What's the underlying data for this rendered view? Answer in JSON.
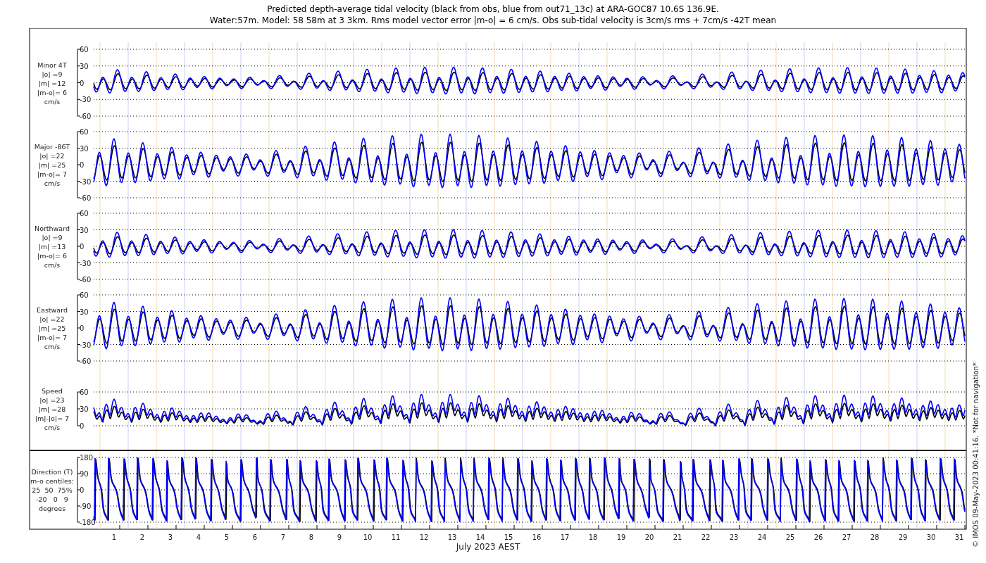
{
  "title": [
    "Predicted depth-average tidal velocity (black from obs, blue from out71_13c) at ARA-GOC87 10.6S 136.9E.",
    "Water:57m. Model: 58 58m at 3 3km. Rms model vector error |m-o| = 6 cm/s. Obs sub-tidal velocity is 3cm/s rms + 7cm/s -42T mean"
  ],
  "panels": [
    {
      "kind": "minor",
      "label": [
        "Minor 4T",
        "|o| =9",
        "|m| =12",
        "|m-o|= 6",
        "cm/s"
      ],
      "yticks": [
        "60",
        "30",
        "0",
        "-30",
        "-60"
      ]
    },
    {
      "kind": "major",
      "label": [
        "Major -86T",
        "|o| =22",
        "|m| =25",
        "|m-o|= 7",
        "cm/s"
      ],
      "yticks": [
        "60",
        "30",
        "0",
        "-30",
        "-60"
      ]
    },
    {
      "kind": "northward",
      "label": [
        "Northward",
        "|o| =9",
        "|m| =13",
        "|m-o|= 6",
        "cm/s"
      ],
      "yticks": [
        "60",
        "30",
        "0",
        "-30",
        "-60"
      ]
    },
    {
      "kind": "eastward",
      "label": [
        "Eastward",
        "|o| =22",
        "|m| =25",
        "|m-o|= 7",
        "cm/s"
      ],
      "yticks": [
        "60",
        "30",
        "0",
        "-30",
        "-60"
      ]
    },
    {
      "kind": "speed",
      "label": [
        "Speed",
        "|o| =23",
        "|m| =28",
        "|m|-|o|= 7",
        "cm/s"
      ],
      "yticks": [
        "60",
        "30",
        "0"
      ]
    },
    {
      "kind": "direction",
      "label": [
        "Direction (T)",
        "m-o centiles:",
        "25  50  75%",
        "-20   0   9",
        "degrees"
      ],
      "yticks": [
        "180",
        "90",
        "0",
        "-90",
        "-180"
      ]
    }
  ],
  "x_tick_labels": [
    "1",
    "2",
    "3",
    "4",
    "5",
    "6",
    "7",
    "8",
    "9",
    "10",
    "11",
    "12",
    "13",
    "14",
    "15",
    "16",
    "17",
    "18",
    "19",
    "20",
    "21",
    "22",
    "23",
    "24",
    "25",
    "26",
    "27",
    "28",
    "29",
    "30",
    "31"
  ],
  "xlabel": "July 2023 AEST",
  "credit": "© IMOS 09-May-2023 00:41:16. *Not for navigation*"
}
